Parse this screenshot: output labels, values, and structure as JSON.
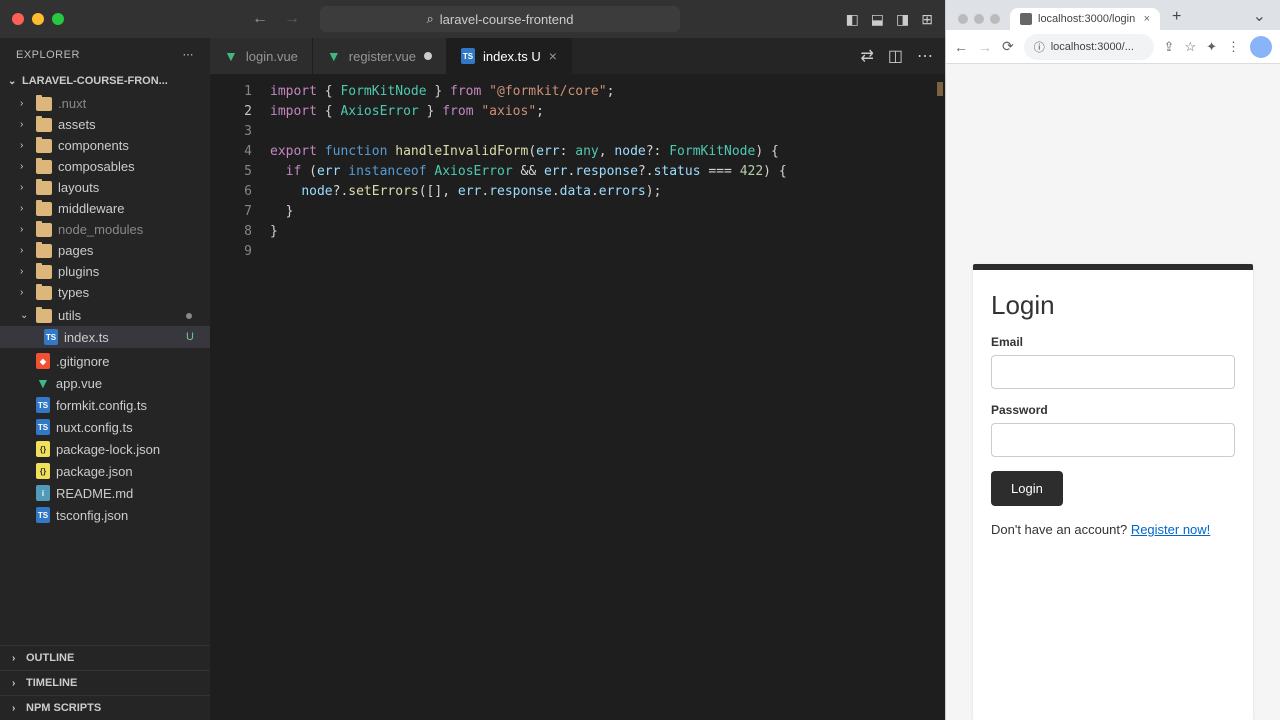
{
  "titlebar": {
    "project": "laravel-course-frontend"
  },
  "sidebar": {
    "title": "EXPLORER",
    "project": "LARAVEL-COURSE-FRON...",
    "folders": [
      {
        "name": ".nuxt",
        "dimmed": true
      },
      {
        "name": "assets"
      },
      {
        "name": "components"
      },
      {
        "name": "composables"
      },
      {
        "name": "layouts"
      },
      {
        "name": "middleware"
      },
      {
        "name": "node_modules",
        "dimmed": true
      },
      {
        "name": "pages"
      },
      {
        "name": "plugins"
      },
      {
        "name": "types"
      }
    ],
    "utilsFolder": "utils",
    "utilsFile": {
      "name": "index.ts",
      "status": "U"
    },
    "files": [
      {
        "name": ".gitignore",
        "icon": "git"
      },
      {
        "name": "app.vue",
        "icon": "vue"
      },
      {
        "name": "formkit.config.ts",
        "icon": "ts"
      },
      {
        "name": "nuxt.config.ts",
        "icon": "ts"
      },
      {
        "name": "package-lock.json",
        "icon": "json"
      },
      {
        "name": "package.json",
        "icon": "json"
      },
      {
        "name": "README.md",
        "icon": "md"
      },
      {
        "name": "tsconfig.json",
        "icon": "ts"
      }
    ],
    "sections": [
      "OUTLINE",
      "TIMELINE",
      "NPM SCRIPTS"
    ]
  },
  "tabs": [
    {
      "name": "login.vue",
      "icon": "vue"
    },
    {
      "name": "register.vue",
      "icon": "vue",
      "dirty": true
    },
    {
      "name": "index.ts U",
      "icon": "ts",
      "active": true
    }
  ],
  "code": {
    "lines": [
      "1",
      "2",
      "3",
      "4",
      "5",
      "6",
      "7",
      "8",
      "9"
    ],
    "activeLine": 1
  },
  "browser": {
    "tab": "localhost:3000/login",
    "url": "localhost:3000/...",
    "login": {
      "title": "Login",
      "emailLabel": "Email",
      "passwordLabel": "Password",
      "button": "Login",
      "registerText": "Don't have an account? ",
      "registerLink": "Register now!"
    }
  }
}
